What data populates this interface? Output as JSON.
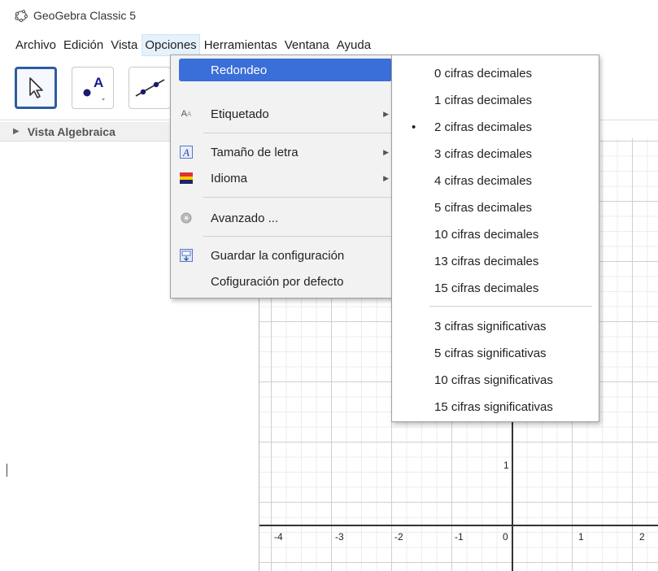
{
  "window": {
    "title": "GeoGebra Classic 5"
  },
  "menubar": {
    "items": [
      "Archivo",
      "Edición",
      "Vista",
      "Opciones",
      "Herramientas",
      "Ventana",
      "Ayuda"
    ],
    "active": "Opciones"
  },
  "toolbar": {
    "tools": [
      {
        "name": "move-tool",
        "icon": "arrow-cursor-icon"
      },
      {
        "name": "point-tool",
        "icon": "point-icon",
        "label": "A"
      },
      {
        "name": "line-tool",
        "icon": "line-icon"
      }
    ]
  },
  "algebra_view": {
    "header": "Vista Algebraica"
  },
  "graphics_view": {
    "x_ticks": [
      "-4",
      "-3",
      "-2",
      "-1",
      "0",
      "1",
      "2"
    ],
    "y_ticks": [
      "1"
    ],
    "accent": "#333333"
  },
  "opciones_menu": {
    "items": [
      {
        "label": "Redondeo",
        "icon": "",
        "submenu": true,
        "highlighted": true
      },
      {
        "label": "Etiquetado",
        "icon": "label-aa-icon",
        "submenu": true
      },
      {
        "label": "Tamaño de letra",
        "icon": "font-size-icon",
        "submenu": true
      },
      {
        "label": "Idioma",
        "icon": "language-flag-icon",
        "submenu": true
      },
      {
        "label": "Avanzado ...",
        "icon": "gear-icon"
      },
      {
        "label": "Guardar la configuración",
        "icon": "save-settings-icon"
      },
      {
        "label": "Cofiguración por defecto",
        "icon": ""
      }
    ],
    "highlight_color": "#3a6ed8"
  },
  "redondeo_menu": {
    "decimal_options": [
      "0 cifras decimales",
      "1 cifras decimales",
      "2 cifras decimales",
      "3 cifras decimales",
      "4 cifras decimales",
      "5 cifras decimales",
      "10 cifras decimales",
      "13 cifras decimales",
      "15 cifras decimales"
    ],
    "significant_options": [
      "3 cifras significativas",
      "5 cifras significativas",
      "10 cifras significativas",
      "15 cifras significativas"
    ],
    "selected": "2 cifras decimales",
    "bullet": "•"
  }
}
